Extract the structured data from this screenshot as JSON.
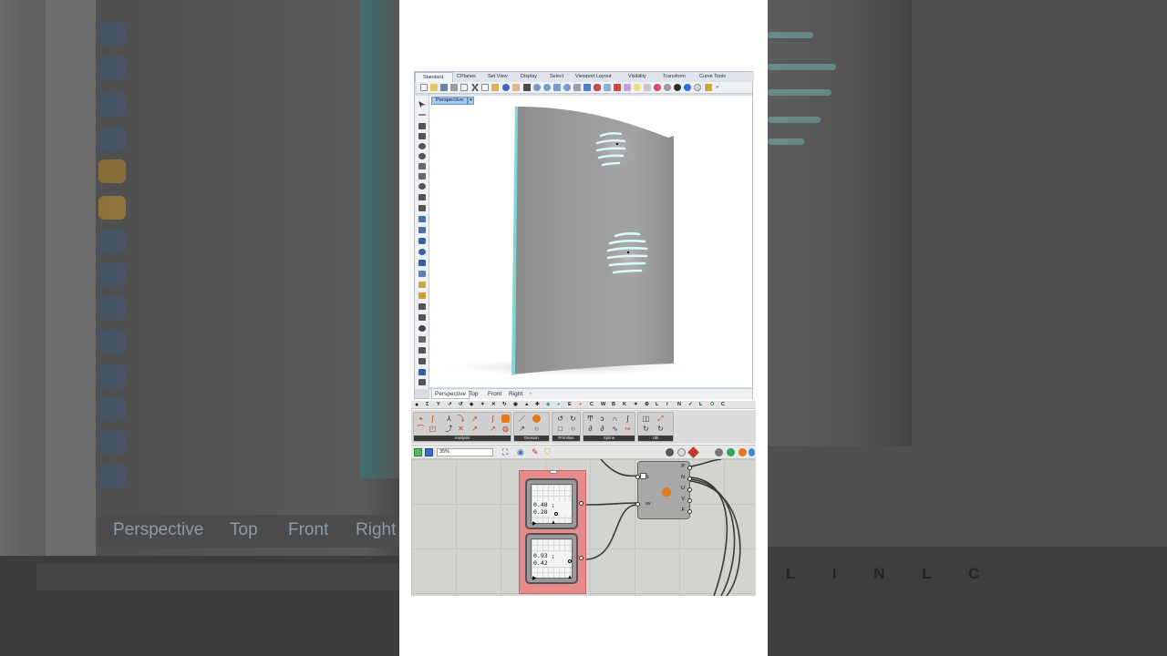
{
  "rhino": {
    "menu_tabs": [
      "Standard",
      "CPlanes",
      "Set View",
      "Display",
      "Select",
      "Viewport Layout",
      "Visibility",
      "Transform",
      "Curve Tools"
    ],
    "active_viewport": "Perspective",
    "viewport_tabs": [
      "Perspective",
      "Top",
      "Front",
      "Right"
    ],
    "add_tab": "+"
  },
  "grasshopper": {
    "category_letters": [
      "E",
      "C",
      "W",
      "B",
      "K",
      "L",
      "I",
      "N",
      "L",
      "O",
      "C"
    ],
    "ribbon_groups": [
      "Analysis",
      "Division",
      "Primitive",
      "Spline",
      "Util"
    ],
    "zoom": "35%",
    "sliders": [
      {
        "value": "0.48 ; 0.28"
      },
      {
        "value": "0.93 ; 0.42"
      }
    ],
    "node": {
      "inputs": [
        "S",
        "uv"
      ],
      "outputs": [
        "P",
        "N",
        "U",
        "V",
        "F"
      ]
    }
  },
  "background": {
    "left_view_tabs": [
      "Perspective",
      "Top",
      "Front",
      "Right"
    ],
    "right_letters": "L I N L C"
  },
  "colors": {
    "wall_edge": "#7fd6d6",
    "group_fill": "#e58b8b",
    "viewport_label": "#a7c7ee"
  }
}
